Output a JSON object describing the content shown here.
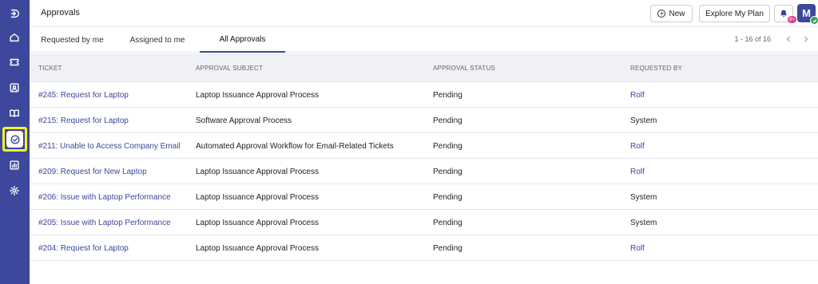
{
  "header": {
    "title": "Approvals",
    "new_label": "New",
    "plan_label": "Explore My Plan",
    "notification_badge": "9+",
    "avatar_letter": "M"
  },
  "tabs": [
    {
      "label": "Requested by me"
    },
    {
      "label": "Assigned to me"
    },
    {
      "label": "All Approvals",
      "active": true
    }
  ],
  "pagination": {
    "text": "1 - 16 of 16"
  },
  "table": {
    "columns": [
      "TICKET",
      "APPROVAL SUBJECT",
      "APPROVAL STATUS",
      "REQUESTED BY"
    ],
    "rows": [
      {
        "ticket": "#245: Request for Laptop",
        "subject": "Laptop Issuance Approval Process",
        "status": "Pending",
        "requested_by": "Rolf"
      },
      {
        "ticket": "#215: Request for Laptop",
        "subject": "Software Approval Process",
        "status": "Pending",
        "requested_by": "System"
      },
      {
        "ticket": "#211: Unable to Access Company Email",
        "subject": "Automated Approval Workflow for Email-Related Tickets",
        "status": "Pending",
        "requested_by": "Rolf"
      },
      {
        "ticket": "#209: Request for New Laptop",
        "subject": "Laptop Issuance Approval Process",
        "status": "Pending",
        "requested_by": "Rolf"
      },
      {
        "ticket": "#206: Issue with Laptop Performance",
        "subject": "Laptop Issuance Approval Process",
        "status": "Pending",
        "requested_by": "System"
      },
      {
        "ticket": "#205: Issue with Laptop Performance",
        "subject": "Laptop Issuance Approval Process",
        "status": "Pending",
        "requested_by": "System"
      },
      {
        "ticket": "#204: Request for Laptop",
        "subject": "Laptop Issuance Approval Process",
        "status": "Pending",
        "requested_by": "Rolf"
      }
    ]
  },
  "sidebar": {
    "icons": [
      "logo-icon",
      "home-icon",
      "ticket-icon",
      "contacts-icon",
      "knowledge-base-icon",
      "approvals-icon",
      "reports-icon",
      "settings-icon"
    ],
    "active": "approvals-icon"
  },
  "colors": {
    "sidebar": "#3d479b",
    "accent": "#3d479b",
    "highlight": "#f2f12a",
    "badge": "#e0428f",
    "online": "#2ba84a"
  }
}
